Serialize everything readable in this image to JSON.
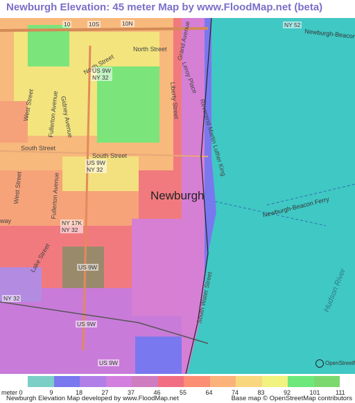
{
  "title": "Newburgh Elevation: 45 meter Map by www.FloodMap.net (beta)",
  "map": {
    "city_label": "Newburgh",
    "street_labels": [
      {
        "id": "north-street",
        "text": "North Street"
      },
      {
        "id": "north-street-2",
        "text": "North Street"
      },
      {
        "id": "grand-avenue",
        "text": "Grand Avenue"
      },
      {
        "id": "leroy-place",
        "text": "Leroy Place"
      },
      {
        "id": "liberty-street",
        "text": "Liberty Street"
      },
      {
        "id": "martin-luther-king",
        "text": "Reverend Martin Luther King"
      },
      {
        "id": "west-street",
        "text": "West Street"
      },
      {
        "id": "fullerton-avenue",
        "text": "Fullerton Avenue"
      },
      {
        "id": "gidney-avenue",
        "text": "Gidney Avenue"
      },
      {
        "id": "south-street",
        "text": "South Street"
      },
      {
        "id": "south-street-2",
        "text": "South Street"
      },
      {
        "id": "west-street-2",
        "text": "West Street"
      },
      {
        "id": "fullerton-avenue-2",
        "text": "Fullerton Avenue"
      },
      {
        "id": "lake-street",
        "text": "Lake Street"
      },
      {
        "id": "south-water-street",
        "text": "South Water Street"
      },
      {
        "id": "broadway",
        "text": "Broadway"
      }
    ],
    "shields": [
      {
        "id": "i-10",
        "text": "10"
      },
      {
        "id": "i-10s",
        "text": "10S"
      },
      {
        "id": "i-10n",
        "text": "10N"
      },
      {
        "id": "ny-52",
        "text": "NY 52"
      },
      {
        "id": "us9w-ny32-north",
        "text": "US 9W\nNY 32"
      },
      {
        "id": "us9w-ny32-south",
        "text": "US 9W\nNY 32"
      },
      {
        "id": "ny17k-ny32",
        "text": "NY 17K\nNY 32"
      },
      {
        "id": "us9w-1",
        "text": "US 9W"
      },
      {
        "id": "ny-32",
        "text": "NY 32"
      },
      {
        "id": "us9w-2",
        "text": "US 9W"
      },
      {
        "id": "us9w-3",
        "text": "US 9W"
      }
    ],
    "road_label_newburgh_beacon": "Newburgh-Beacon",
    "ferry_label": "Newburgh-Beacon Ferry",
    "river_label": "Hudson River",
    "osm_logo_text": "OpenStreetMap",
    "colors": {
      "water": "#40c8c4",
      "deep_water": "#3ab4b8"
    }
  },
  "legend": {
    "unit_label": "meter",
    "ticks": [
      "0",
      "9",
      "18",
      "27",
      "37",
      "46",
      "55",
      "64",
      "74",
      "83",
      "92",
      "101",
      "111"
    ],
    "colors": [
      "#7bcfc6",
      "#7a78ee",
      "#b07ee6",
      "#d27fdf",
      "#cf7dc0",
      "#f16e82",
      "#fb8e73",
      "#fbb37b",
      "#f8d77f",
      "#f2f27f",
      "#6ee87a",
      "#7bd86e"
    ]
  },
  "footer": {
    "left": "Newburgh Elevation Map developed by www.FloodMap.net",
    "right": "Base map © OpenStreetMap contributors"
  }
}
